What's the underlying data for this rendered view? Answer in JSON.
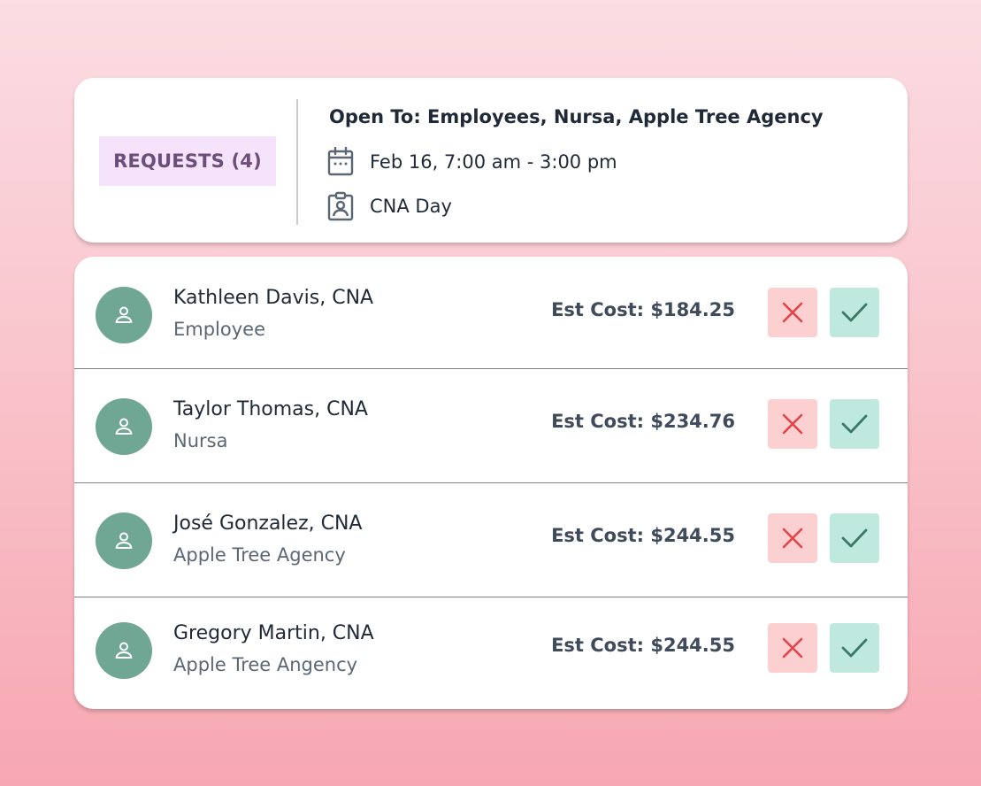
{
  "header": {
    "requests_label": "REQUESTS (4)",
    "open_to": "Open To: Employees, Nursa, Apple Tree Agency",
    "date_time": "Feb 16, 7:00 am - 3:00 pm",
    "shift_type": "CNA Day"
  },
  "requests": [
    {
      "name": "Kathleen Davis, CNA",
      "source": "Employee",
      "cost": "Est Cost: $184.25"
    },
    {
      "name": "Taylor Thomas, CNA",
      "source": "Nursa",
      "cost": "Est Cost: $234.76"
    },
    {
      "name": "José Gonzalez, CNA",
      "source": "Apple Tree Agency",
      "cost": "Est Cost: $244.55"
    },
    {
      "name": "Gregory Martin, CNA",
      "source": "Apple Tree Angency",
      "cost": "Est Cost: $244.55"
    }
  ],
  "icons": {
    "calendar": "calendar-icon",
    "badge": "id-badge-icon",
    "avatar": "user-icon",
    "decline": "close-icon",
    "approve": "check-icon"
  },
  "colors": {
    "badge_bg": "#f4e3fb",
    "badge_text": "#6b4f7a",
    "avatar_bg": "#6fa694",
    "decline_bg": "#fcd0d0",
    "decline_icon": "#e0474a",
    "approve_bg": "#bfe8de",
    "approve_icon": "#3a7a63"
  }
}
